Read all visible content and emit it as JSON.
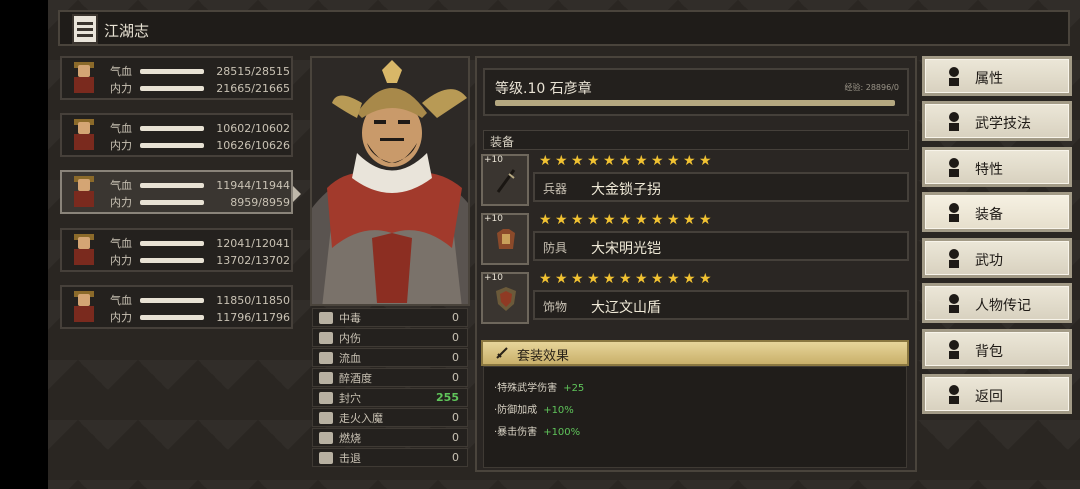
{
  "header": {
    "title": "江湖志"
  },
  "roster": [
    {
      "hp_label": "气血",
      "hp": "28515/28515",
      "mp_label": "内力",
      "mp": "21665/21665"
    },
    {
      "hp_label": "气血",
      "hp": "10602/10602",
      "mp_label": "内力",
      "mp": "10626/10626"
    },
    {
      "hp_label": "气血",
      "hp": "11944/11944",
      "mp_label": "内力",
      "mp": "8959/8959"
    },
    {
      "hp_label": "气血",
      "hp": "12041/12041",
      "mp_label": "内力",
      "mp": "13702/13702"
    },
    {
      "hp_label": "气血",
      "hp": "11850/11850",
      "mp_label": "内力",
      "mp": "11796/11796"
    }
  ],
  "status": [
    {
      "label": "中毒",
      "value": "0",
      "icon": "skull-icon"
    },
    {
      "label": "内伤",
      "value": "0",
      "icon": "broken-heart-icon"
    },
    {
      "label": "流血",
      "value": "0",
      "icon": "blood-drop-icon"
    },
    {
      "label": "醉酒度",
      "value": "0",
      "icon": "drunk-icon"
    },
    {
      "label": "封穴",
      "value": "255",
      "icon": "acupoint-icon",
      "value_color": "#5fc45a"
    },
    {
      "label": "走火入魔",
      "value": "0",
      "icon": "demon-icon"
    },
    {
      "label": "燃烧",
      "value": "0",
      "icon": "fire-icon"
    },
    {
      "label": "击退",
      "value": "0",
      "icon": "boot-icon"
    }
  ],
  "character": {
    "level_name": "等级.10 石彦章",
    "exp": "经验: 28896/0",
    "exp_fill": 1.0
  },
  "equipment": {
    "header": "装备",
    "items": [
      {
        "plus": "+10",
        "stars": 11,
        "slot": "兵器",
        "name": "大金锁子拐",
        "icon": "staff-icon"
      },
      {
        "plus": "+10",
        "stars": 11,
        "slot": "防具",
        "name": "大宋明光铠",
        "icon": "armor-icon"
      },
      {
        "plus": "+10",
        "stars": 11,
        "slot": "饰物",
        "name": "大辽文山盾",
        "icon": "shield-icon"
      }
    ]
  },
  "set_effect": {
    "title": "套装效果",
    "lines": [
      {
        "text": "·特殊武学伤害",
        "bonus": "+25"
      },
      {
        "text": "·防御加成",
        "bonus": "+10%"
      },
      {
        "text": "·暴击伤害",
        "bonus": "+100%"
      }
    ]
  },
  "menu": [
    {
      "label": "属性",
      "icon": "person-icon",
      "active": false
    },
    {
      "label": "武学技法",
      "icon": "martial-person-icon",
      "active": false
    },
    {
      "label": "特性",
      "icon": "trait-icon",
      "active": false
    },
    {
      "label": "装备",
      "icon": "sword-icon",
      "active": true
    },
    {
      "label": "武功",
      "icon": "manual-book-icon",
      "active": false
    },
    {
      "label": "人物传记",
      "icon": "diamond-icon",
      "active": false
    },
    {
      "label": "背包",
      "icon": "bag-icon",
      "active": false
    },
    {
      "label": "返回",
      "icon": "door-icon",
      "active": false
    }
  ],
  "colors": {
    "accent_green": "#5fc45a",
    "star": "#f1c232",
    "set_header": "#e7d59a"
  }
}
